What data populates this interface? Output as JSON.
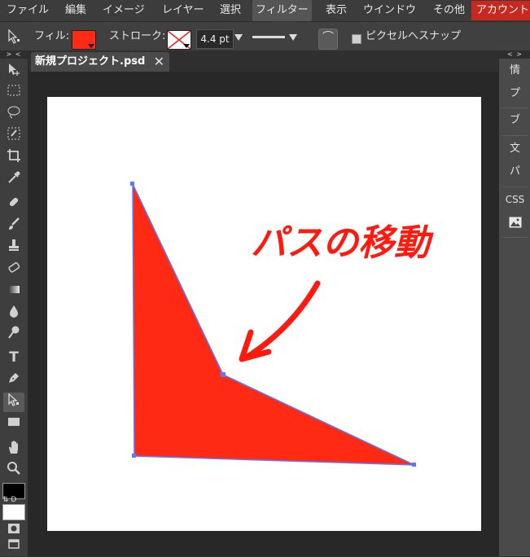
{
  "menu": {
    "items": [
      "ファイル",
      "編集",
      "イメージ",
      "レイヤー",
      "選択",
      "フィルター",
      "表示",
      "ウインドウ",
      "その他"
    ],
    "active_item": "フィルター",
    "account": "アカウント"
  },
  "options": {
    "fill_label": "フィル:",
    "fill_color": "#ff2a14",
    "stroke_label": "ストローク:",
    "stroke_width": "4.4 pt",
    "snap_label": "ピクセルへスナップ"
  },
  "toolbar": {
    "collapse": "> <",
    "swap_label": "⇅ D"
  },
  "document": {
    "tab_title": "新規プロジェクト.psd",
    "annotation_text": "パスの移動",
    "shape_color": "#ff2a14",
    "path_color": "#5b78ff"
  },
  "right_panel": {
    "collapse": "< >",
    "items": [
      "情",
      "プ",
      "ブ",
      "文",
      "パ",
      "CSS"
    ]
  },
  "colors": {
    "menu_bg": "#3c3c3c",
    "panel_bg": "#404040",
    "accent_account": "#c8281e"
  }
}
